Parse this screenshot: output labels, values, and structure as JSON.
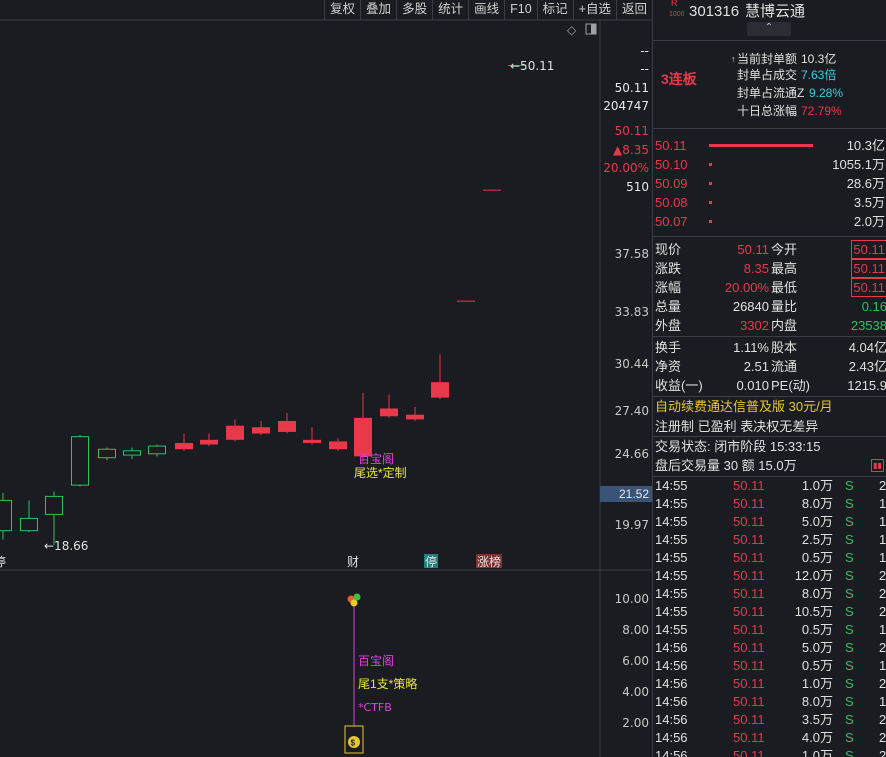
{
  "toolbar": [
    "复权",
    "叠加",
    "多股",
    "统计",
    "画线",
    "F10",
    "标记",
    "+自选",
    "返回"
  ],
  "chart_data": {
    "type": "candlestick",
    "price_axis_labels": [
      "--",
      "--",
      "50.11",
      "204747",
      "50.11",
      "▲8.35",
      "20.00%",
      "510",
      "37.58",
      "33.83",
      "30.44",
      "27.40",
      "24.66",
      "21.52",
      "19.97"
    ],
    "price_axis_ticks": [
      37.58,
      33.83,
      30.44,
      27.4,
      24.66,
      19.97
    ],
    "current_price_badge": "21.52",
    "high_marker": "50.11",
    "low_marker": "18.66",
    "candles": [
      {
        "o": 19.6,
        "h": 21.6,
        "l": 19.0,
        "c": 21.2,
        "color": "green"
      },
      {
        "o": 20.3,
        "h": 21.2,
        "l": 19.5,
        "c": 19.6,
        "color": "green"
      },
      {
        "o": 20.5,
        "h": 21.7,
        "l": 18.66,
        "c": 21.4,
        "color": "green"
      },
      {
        "o": 22.2,
        "h": 25.8,
        "l": 22.1,
        "c": 25.7,
        "color": "green"
      },
      {
        "o": 24.3,
        "h": 25.0,
        "l": 24.1,
        "c": 24.9,
        "color": "green"
      },
      {
        "o": 24.5,
        "h": 25.0,
        "l": 24.2,
        "c": 24.8,
        "color": "green"
      },
      {
        "o": 24.6,
        "h": 25.2,
        "l": 24.4,
        "c": 25.1,
        "color": "green"
      },
      {
        "o": 25.3,
        "h": 25.9,
        "l": 24.8,
        "c": 24.9,
        "color": "red"
      },
      {
        "o": 25.5,
        "h": 25.9,
        "l": 25.1,
        "c": 25.2,
        "color": "red"
      },
      {
        "o": 26.4,
        "h": 26.8,
        "l": 25.4,
        "c": 25.5,
        "color": "red"
      },
      {
        "o": 26.3,
        "h": 26.7,
        "l": 25.8,
        "c": 25.9,
        "color": "red"
      },
      {
        "o": 26.7,
        "h": 27.2,
        "l": 25.9,
        "c": 26.0,
        "color": "red"
      },
      {
        "o": 25.5,
        "h": 26.3,
        "l": 25.2,
        "c": 25.3,
        "color": "red"
      },
      {
        "o": 25.4,
        "h": 25.6,
        "l": 24.8,
        "c": 24.9,
        "color": "red"
      },
      {
        "o": 26.9,
        "h": 28.5,
        "l": 24.0,
        "c": 24.4,
        "color": "red"
      },
      {
        "o": 27.5,
        "h": 28.4,
        "l": 26.9,
        "c": 27.0,
        "color": "red"
      },
      {
        "o": 27.1,
        "h": 27.6,
        "l": 26.7,
        "c": 26.8,
        "color": "red"
      },
      {
        "o": 29.2,
        "h": 31.0,
        "l": 28.1,
        "c": 28.2,
        "color": "red"
      },
      {
        "o": 34.5,
        "h": 34.5,
        "l": 34.5,
        "c": 34.5,
        "color": "red"
      },
      {
        "o": 41.8,
        "h": 41.8,
        "l": 41.8,
        "c": 41.8,
        "color": "red"
      },
      {
        "o": 50.11,
        "h": 50.11,
        "l": 50.11,
        "c": 50.11,
        "color": "red"
      }
    ],
    "event_markers": [
      "财",
      "停",
      "涨榜"
    ],
    "event_left_mark": "停",
    "annotations_main": [
      "百宝阁",
      "尾选*定制"
    ],
    "indicator_axis": [
      "10.00",
      "8.00",
      "6.00",
      "4.00",
      "2.00"
    ],
    "annotations_sub": [
      "百宝阁",
      "尾1支*策略",
      "*CTFB"
    ]
  },
  "quote": {
    "code": "301316",
    "name": "慧博云通",
    "badge_r": "R",
    "badge_num": "1000",
    "streak": "3连板",
    "seal_amount_label": "当前封单额",
    "seal_amount": "10.3亿",
    "seal_ratio_label": "封单占成交",
    "seal_ratio": "7.63倍",
    "seal_float_label": "封单占流通Z",
    "seal_float": "9.28%",
    "ten_day_label": "十日总涨幅",
    "ten_day": "72.79%",
    "bids": [
      {
        "price": "50.11",
        "vol": "10.3亿",
        "bar": 1.0
      },
      {
        "price": "50.10",
        "vol": "1055.1万",
        "bar": 0.02
      },
      {
        "price": "50.09",
        "vol": "28.6万",
        "bar": 0.02
      },
      {
        "price": "50.08",
        "vol": "3.5万",
        "bar": 0.02
      },
      {
        "price": "50.07",
        "vol": "2.0万",
        "bar": 0.02
      }
    ],
    "stats": [
      [
        "现价",
        "50.11",
        "今开",
        "50.11"
      ],
      [
        "涨跌",
        "8.35",
        "最高",
        "50.11"
      ],
      [
        "涨幅",
        "20.00%",
        "最低",
        "50.11"
      ],
      [
        "总量",
        "26840",
        "量比",
        "0.16"
      ],
      [
        "外盘",
        "3302",
        "内盘",
        "23538"
      ]
    ],
    "stats2": [
      [
        "换手",
        "1.11%",
        "股本",
        "4.04亿"
      ],
      [
        "净资",
        "2.51",
        "流通",
        "2.43亿"
      ],
      [
        "收益(一)",
        "0.010",
        "PE(动)",
        "1215.9"
      ]
    ],
    "promo": "自动续费通达信普及版  30元/月",
    "reg": "注册制 已盈利 表决权无差异",
    "trade_status": "交易状态: 闭市阶段 15:33:15",
    "after_hours": "盘后交易量 30 额 15.0万",
    "ticks": [
      [
        "14:55",
        "50.11",
        "1.0万",
        "S",
        "2"
      ],
      [
        "14:55",
        "50.11",
        "8.0万",
        "S",
        "1"
      ],
      [
        "14:55",
        "50.11",
        "5.0万",
        "S",
        "1"
      ],
      [
        "14:55",
        "50.11",
        "2.5万",
        "S",
        "1"
      ],
      [
        "14:55",
        "50.11",
        "0.5万",
        "S",
        "1"
      ],
      [
        "14:55",
        "50.11",
        "12.0万",
        "S",
        "2"
      ],
      [
        "14:55",
        "50.11",
        "8.0万",
        "S",
        "2"
      ],
      [
        "14:55",
        "50.11",
        "10.5万",
        "S",
        "2"
      ],
      [
        "14:55",
        "50.11",
        "0.5万",
        "S",
        "1"
      ],
      [
        "14:56",
        "50.11",
        "5.0万",
        "S",
        "2"
      ],
      [
        "14:56",
        "50.11",
        "0.5万",
        "S",
        "1"
      ],
      [
        "14:56",
        "50.11",
        "1.0万",
        "S",
        "2"
      ],
      [
        "14:56",
        "50.11",
        "8.0万",
        "S",
        "1"
      ],
      [
        "14:56",
        "50.11",
        "3.5万",
        "S",
        "2"
      ],
      [
        "14:56",
        "50.11",
        "4.0万",
        "S",
        "2"
      ],
      [
        "14:56",
        "50.11",
        "1.0万",
        "S",
        "2"
      ]
    ]
  }
}
